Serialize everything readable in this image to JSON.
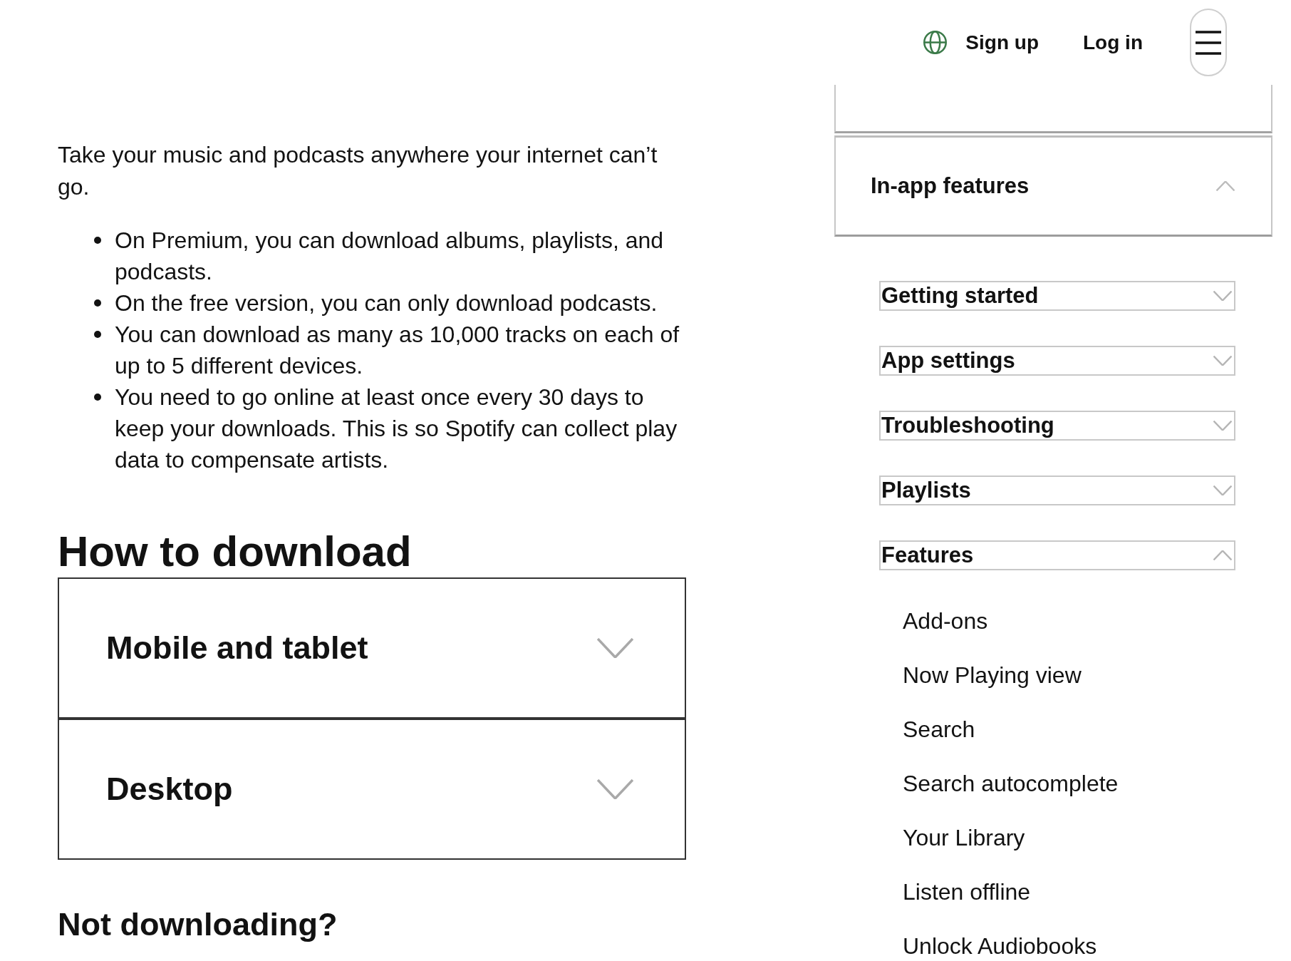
{
  "header": {
    "sign_up": "Sign up",
    "log_in": "Log in"
  },
  "article": {
    "intro": "Take your music and podcasts anywhere your internet can’t go.",
    "bullets": [
      "On Premium, you can download albums, playlists, and podcasts.",
      "On the free version, you can only download podcasts.",
      "You can download as many as 10,000 tracks on each of up to 5 different devices.",
      "You need to go online at least once every 30 days to keep your downloads. This is so Spotify can collect play data to compensate artists."
    ],
    "heading": "How to download",
    "accordion": [
      {
        "label": "Mobile and tablet",
        "expanded": false
      },
      {
        "label": "Desktop",
        "expanded": false
      }
    ],
    "subheading": "Not downloading?"
  },
  "sidebar": {
    "category": {
      "label": "In-app features",
      "expanded": true
    },
    "topics": [
      {
        "label": "Getting started",
        "expanded": false
      },
      {
        "label": "App settings",
        "expanded": false
      },
      {
        "label": "Troubleshooting",
        "expanded": false
      },
      {
        "label": "Playlists",
        "expanded": false
      },
      {
        "label": "Features",
        "expanded": true,
        "children": [
          {
            "label": "Add-ons"
          },
          {
            "label": "Now Playing view"
          },
          {
            "label": "Search"
          },
          {
            "label": "Search autocomplete"
          },
          {
            "label": "Your Library"
          },
          {
            "label": "Listen offline"
          },
          {
            "label": "Unlock Audiobooks"
          }
        ]
      }
    ]
  }
}
